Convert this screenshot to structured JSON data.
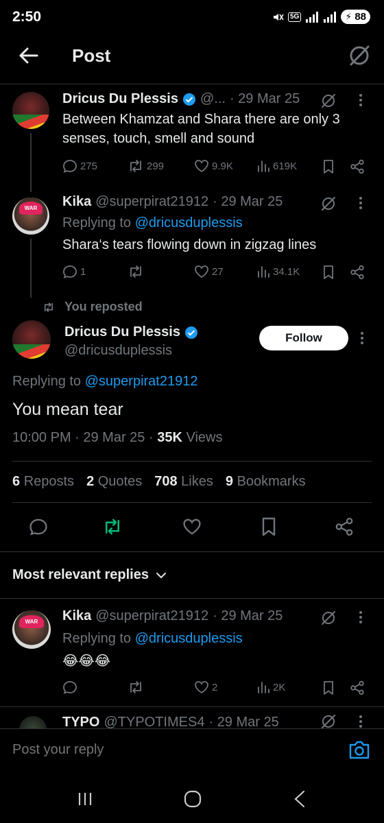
{
  "status_bar": {
    "time": "2:50",
    "network": "5G",
    "battery": "88",
    "icons": [
      "mute-icon",
      "signal-icon",
      "signal-icon",
      "battery-icon"
    ]
  },
  "header": {
    "title": "Post"
  },
  "tweet1": {
    "author": "Dricus Du Plessis",
    "handle": "@...",
    "date": "· 29 Mar 25",
    "text": "Between Khamzat and Shara there are only 3 senses, touch, smell and sound",
    "replies": "275",
    "reposts": "299",
    "likes": "9.9K",
    "views": "619K"
  },
  "tweet2": {
    "author": "Kika",
    "handle": "@superpirat21912",
    "date": "· 29 Mar 25",
    "replying_prefix": "Replying to ",
    "replying_to": "@dricusduplessis",
    "text": "Shara‘s tears flowing down in zigzag lines",
    "replies": "1",
    "reposts": "",
    "likes": "27",
    "views": "34.1K"
  },
  "repost_label": "You reposted",
  "main": {
    "author": "Dricus Du Plessis",
    "handle": "@dricusduplessis",
    "follow_label": "Follow",
    "replying_prefix": "Replying to ",
    "replying_to": "@superpirat21912",
    "text": "You mean tear",
    "time": "10:00 PM · 29 Mar 25 · ",
    "views_count": "35K",
    "views_label": " Views",
    "stats": [
      {
        "num": "6",
        "label": "Reposts"
      },
      {
        "num": "2",
        "label": "Quotes"
      },
      {
        "num": "708",
        "label": "Likes"
      },
      {
        "num": "9",
        "label": "Bookmarks"
      }
    ],
    "repost_active_color": "#00ba7c"
  },
  "sort": {
    "label": "Most relevant replies"
  },
  "reply1": {
    "author": "Kika",
    "handle": "@superpirat21912",
    "date": "· 29 Mar 25",
    "replying_prefix": "Replying to ",
    "replying_to": "@dricusduplessis",
    "text": "😂😂😂",
    "replies": "",
    "reposts": "",
    "likes": "2",
    "views": "2K"
  },
  "reply2_preview": {
    "author": "TYPO",
    "handle": "@TYPOTIMES4",
    "date": "· 29 Mar 25"
  },
  "reply_box": {
    "placeholder": "Post your reply"
  },
  "colors": {
    "accent": "#1d9bf0",
    "background": "#000000",
    "muted": "#71767b"
  }
}
